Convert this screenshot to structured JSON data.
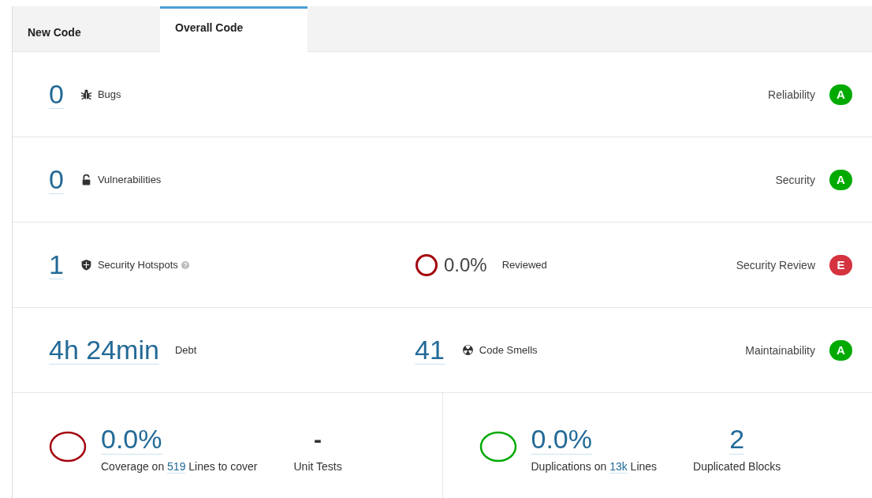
{
  "tabs": [
    {
      "label": "New Code",
      "selected": false
    },
    {
      "label": "Overall Code",
      "selected": true
    }
  ],
  "rows": [
    {
      "kind": "bugs",
      "value": "0",
      "label": "Bugs",
      "rating": {
        "label": "Reliability",
        "grade": "A",
        "color": "#00aa00"
      }
    },
    {
      "kind": "vulnerabilities",
      "value": "0",
      "label": "Vulnerabilities",
      "rating": {
        "label": "Security",
        "grade": "A",
        "color": "#00aa00"
      }
    },
    {
      "kind": "hotspots",
      "value": "1",
      "label": "Security Hotspots",
      "middle": {
        "kind": "ring",
        "value": "0.0%",
        "label": "Reviewed",
        "color": "#a4030f"
      },
      "rating": {
        "label": "Security Review",
        "grade": "E",
        "color": "#d4333f"
      }
    },
    {
      "kind": "debt",
      "value": "4h 24min",
      "label": "Debt",
      "middle": {
        "kind": "smells",
        "value": "41",
        "label": "Code Smells"
      },
      "rating": {
        "label": "Maintainability",
        "grade": "A",
        "color": "#00aa00"
      }
    }
  ],
  "panels": [
    {
      "value": "0.0%",
      "color": "#a4030f",
      "caption_before": "Coverage on",
      "caption_link": "519",
      "caption_after": "Lines to cover",
      "side": {
        "kind": "plain",
        "value": "-",
        "label": "Unit Tests"
      }
    },
    {
      "value": "0.0%",
      "color": "#00aa00",
      "caption_before": "Duplications on",
      "caption_link": "13k",
      "caption_after": "Lines",
      "side": {
        "kind": "link",
        "value": "2",
        "label": "Duplicated Blocks"
      }
    }
  ]
}
